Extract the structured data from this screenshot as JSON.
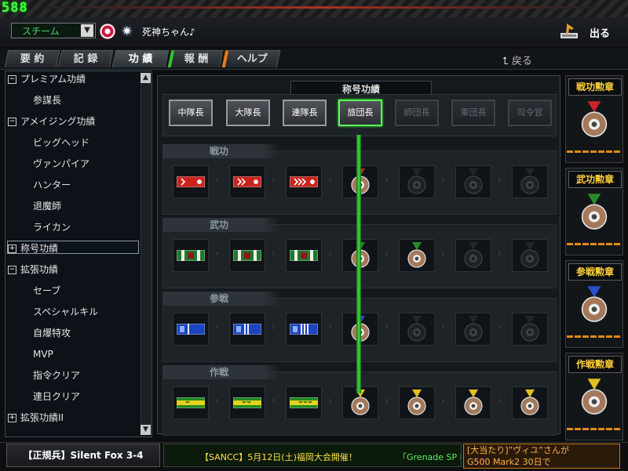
{
  "fps": "588",
  "header": {
    "mode_select": "スチーム",
    "player_name": "死神ちゃん♪",
    "exit_label": "出る"
  },
  "tabs": [
    {
      "label": "要 約"
    },
    {
      "label": "記 録"
    },
    {
      "label": "功 績"
    },
    {
      "label": "報 酬"
    },
    {
      "label": "ヘルプ"
    }
  ],
  "back_label": "戻る",
  "tree": {
    "items": [
      {
        "label": "プレミアム功績",
        "type": "group",
        "sign": "−"
      },
      {
        "label": "参謀長",
        "type": "leaf"
      },
      {
        "label": "アメイジング功績",
        "type": "group",
        "sign": "−"
      },
      {
        "label": "ビッグヘッド",
        "type": "leaf"
      },
      {
        "label": "ヴァンパイア",
        "type": "leaf"
      },
      {
        "label": "ハンター",
        "type": "leaf"
      },
      {
        "label": "退魔師",
        "type": "leaf"
      },
      {
        "label": "ライカン",
        "type": "leaf"
      },
      {
        "label": "称号功績",
        "type": "group",
        "sign": "+",
        "selected": true
      },
      {
        "label": "拡張功績",
        "type": "group",
        "sign": "−"
      },
      {
        "label": "セーブ",
        "type": "leaf"
      },
      {
        "label": "スペシャルキル",
        "type": "leaf"
      },
      {
        "label": "自爆特攻",
        "type": "leaf"
      },
      {
        "label": "MVP",
        "type": "leaf"
      },
      {
        "label": "指令クリア",
        "type": "leaf"
      },
      {
        "label": "連日クリア",
        "type": "leaf"
      },
      {
        "label": "拡張功績II",
        "type": "group",
        "sign": "+"
      }
    ]
  },
  "main": {
    "title": "称号功績",
    "ranks": [
      {
        "label": "中隊長",
        "state": "unlocked"
      },
      {
        "label": "大隊長",
        "state": "unlocked"
      },
      {
        "label": "連隊長",
        "state": "unlocked"
      },
      {
        "label": "旅団長",
        "state": "selected"
      },
      {
        "label": "師団長",
        "state": "locked"
      },
      {
        "label": "軍団長",
        "state": "locked"
      },
      {
        "label": "司令官",
        "state": "locked"
      }
    ],
    "sections": [
      {
        "label": "戦功",
        "ribbon_color": "#c8241c",
        "medal": "#c8242a"
      },
      {
        "label": "武功",
        "ribbon_color": "#1f7a2e",
        "medal": "#2a8a2a"
      },
      {
        "label": "参戦",
        "ribbon_color": "#1c44c0",
        "medal": "#2850d0"
      },
      {
        "label": "作戦",
        "ribbon_color": "#1f8a1f",
        "medal": "#e0c020"
      }
    ]
  },
  "medals": [
    {
      "label": "戦功勲章"
    },
    {
      "label": "武功勲章"
    },
    {
      "label": "参戦勲章"
    },
    {
      "label": "作戦勲章"
    }
  ],
  "bottom": {
    "rank_name": "【正規兵】Silent Fox 3-4",
    "ticker_1": "【SANCC】5月12日(土)福岡大会開催！",
    "ticker_2": "「Grenade SP E",
    "notice_line1": "[大当たり]”ヴィユ”さんが",
    "notice_line2": "G500 Mark2 30日で"
  }
}
